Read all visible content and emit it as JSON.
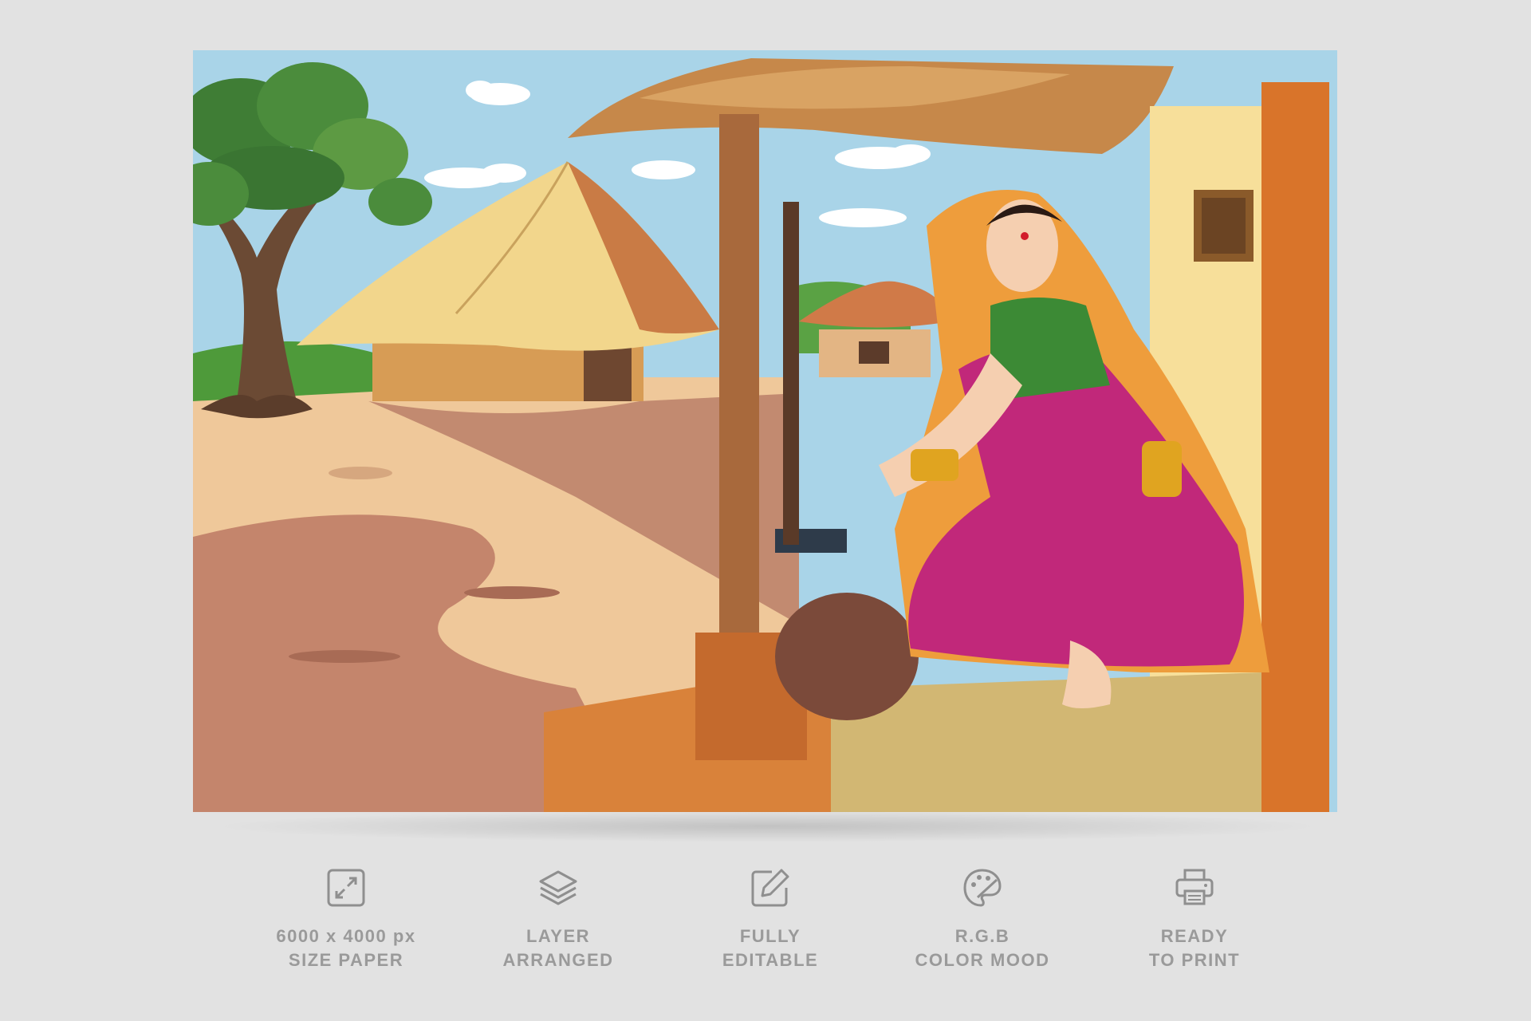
{
  "artwork": {
    "icon": "village-woman-churning-illustration"
  },
  "features": [
    {
      "icon": "resize-icon",
      "line1": "6000 x 4000 px",
      "line2": "SIZE PAPER"
    },
    {
      "icon": "layers-icon",
      "line1": "LAYER",
      "line2": "ARRANGED"
    },
    {
      "icon": "edit-icon",
      "line1": "FULLY",
      "line2": "EDITABLE"
    },
    {
      "icon": "palette-icon",
      "line1": "R.G.B",
      "line2": "COLOR MOOD"
    },
    {
      "icon": "printer-icon",
      "line1": "READY",
      "line2": "TO PRINT"
    }
  ],
  "colors": {
    "background": "#e2e2e2",
    "label": "#9a9a9a"
  }
}
